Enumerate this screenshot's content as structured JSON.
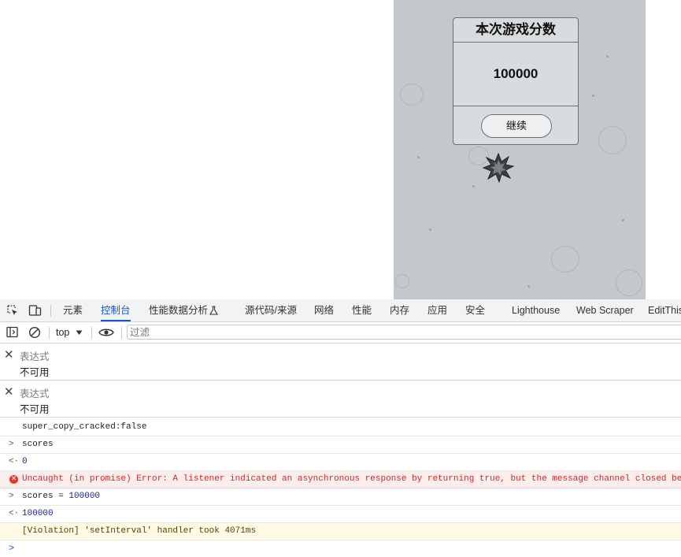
{
  "game": {
    "panel_title": "本次游戏分数",
    "score": "100000",
    "continue_label": "继续"
  },
  "devtools": {
    "tabs": [
      {
        "label": "元素"
      },
      {
        "label": "控制台",
        "active": true
      },
      {
        "label": "性能数据分析"
      },
      {
        "label": "源代码/来源"
      },
      {
        "label": "网络"
      },
      {
        "label": "性能"
      },
      {
        "label": "内存"
      },
      {
        "label": "应用"
      },
      {
        "label": "安全"
      },
      {
        "label": "Lighthouse"
      },
      {
        "label": "Web Scraper"
      },
      {
        "label": "EditThis"
      }
    ],
    "context": "top",
    "filter_placeholder": "过滤",
    "expressions": [
      {
        "label": "表达式",
        "value": "不可用"
      },
      {
        "label": "表达式",
        "value": "不可用"
      }
    ],
    "console": [
      {
        "text": "super_copy_cracked:false"
      },
      {
        "prefix": ">",
        "text": "scores"
      },
      {
        "prefix": "<·",
        "text": "0"
      },
      {
        "type": "error",
        "text": "Uncaught (in promise) Error: A listener indicated an asynchronous response by returning true, but the message channel closed before"
      },
      {
        "prefix": ">",
        "text": "scores = ",
        "number": "100000"
      },
      {
        "prefix": "<·",
        "text": "100000"
      },
      {
        "type": "warning",
        "text": "[Violation] 'setInterval' handler took 4071ms"
      }
    ],
    "prompt_symbol": ">"
  },
  "colors": {
    "game_bg": "#c4c8cb",
    "accent": "#1a56c8",
    "error": "#c62a2a",
    "number": "#1a1aa6"
  }
}
